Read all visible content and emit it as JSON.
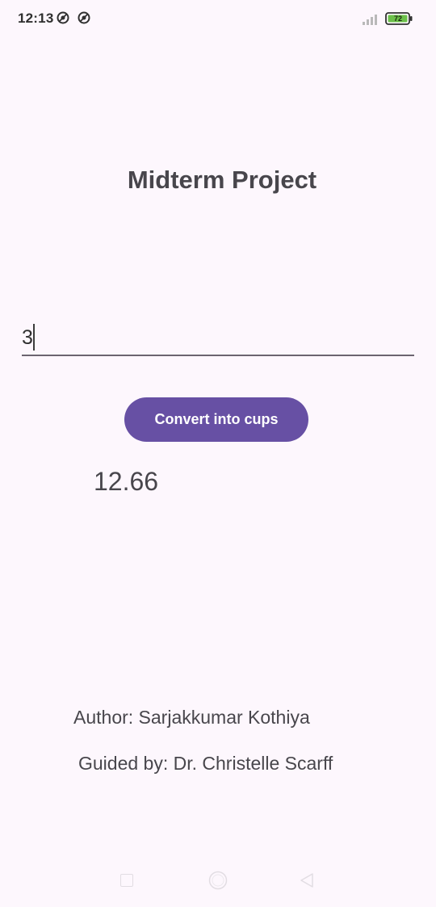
{
  "status_bar": {
    "time": "12:13",
    "battery_level": "72",
    "icons": [
      "notification-icon",
      "notification-icon",
      "signal-icon",
      "battery-icon"
    ]
  },
  "main": {
    "title": "Midterm Project",
    "input": {
      "value": "3"
    },
    "convert_button_label": "Convert into cups",
    "result": "12.66",
    "author": "Author: Sarjakkumar Kothiya",
    "guided_by": "Guided by: Dr. Christelle Scarff"
  },
  "nav_bar": {
    "icons": [
      "recents-square-icon",
      "home-circle-icon",
      "back-triangle-icon"
    ]
  },
  "colors": {
    "background": "#fdf7fd",
    "accent": "#6750a4",
    "text": "#48464c",
    "battery": "#6cc04a"
  }
}
